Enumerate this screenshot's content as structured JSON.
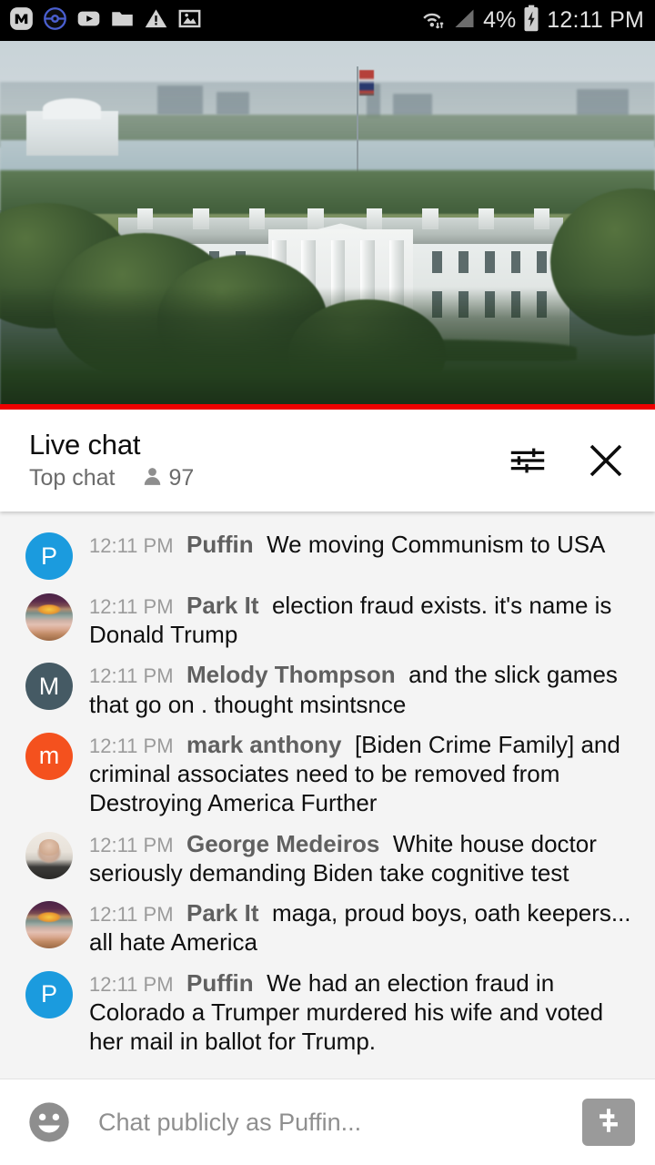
{
  "statusbar": {
    "icons_left": [
      "m-app-icon",
      "pokeball-icon",
      "youtube-icon",
      "folder-icon",
      "warning-triangle-icon",
      "image-icon"
    ],
    "wifi_icon": "wifi-data-icon",
    "signal_icon": "cell-signal-icon",
    "battery_percent": "4%",
    "battery_icon": "battery-charging-icon",
    "clock": "12:11 PM"
  },
  "video": {
    "description": "White House live stream",
    "progress_color": "#ef0000"
  },
  "chat_header": {
    "title": "Live chat",
    "mode": "Top chat",
    "viewer_count": "97",
    "viewer_icon": "person-icon",
    "settings_icon": "tune-icon",
    "close_icon": "close-icon"
  },
  "messages": [
    {
      "time": "12:11 PM",
      "author": "Puffin",
      "text": "We moving Communism to USA",
      "avatar_type": "letter",
      "avatar_letter": "P",
      "avatar_color": "#1b9bde"
    },
    {
      "time": "12:11 PM",
      "author": "Park It",
      "text": "election fraud exists. it's name is Donald Trump",
      "avatar_type": "sunset",
      "avatar_letter": "",
      "avatar_color": "#7a4a50"
    },
    {
      "time": "12:11 PM",
      "author": "Melody Thompson",
      "text": "and the slick games that go on . thought msintsnce",
      "avatar_type": "letter",
      "avatar_letter": "M",
      "avatar_color": "#455a64"
    },
    {
      "time": "12:11 PM",
      "author": "mark anthony",
      "text": "[Biden Crime Family] and criminal associates need to be removed from Destroying America Further",
      "avatar_type": "letter",
      "avatar_letter": "m",
      "avatar_color": "#f4511e"
    },
    {
      "time": "12:11 PM",
      "author": "George Medeiros",
      "text": "White house doctor seriously demanding Biden take cognitive test",
      "avatar_type": "face",
      "avatar_letter": "",
      "avatar_color": "#e8e2da"
    },
    {
      "time": "12:11 PM",
      "author": "Park It",
      "text": "maga, proud boys, oath keepers... all hate America",
      "avatar_type": "sunset",
      "avatar_letter": "",
      "avatar_color": "#7a4a50"
    },
    {
      "time": "12:11 PM",
      "author": "Puffin",
      "text": "We had an election fraud in Colorado a Trumper murdered his wife and voted her mail in ballot for Trump.",
      "avatar_type": "letter",
      "avatar_letter": "P",
      "avatar_color": "#1b9bde"
    }
  ],
  "input_bar": {
    "emoji_icon": "emoji-smiley-icon",
    "placeholder": "Chat publicly as Puffin...",
    "value": "",
    "superchat_icon": "dollar-icon"
  }
}
